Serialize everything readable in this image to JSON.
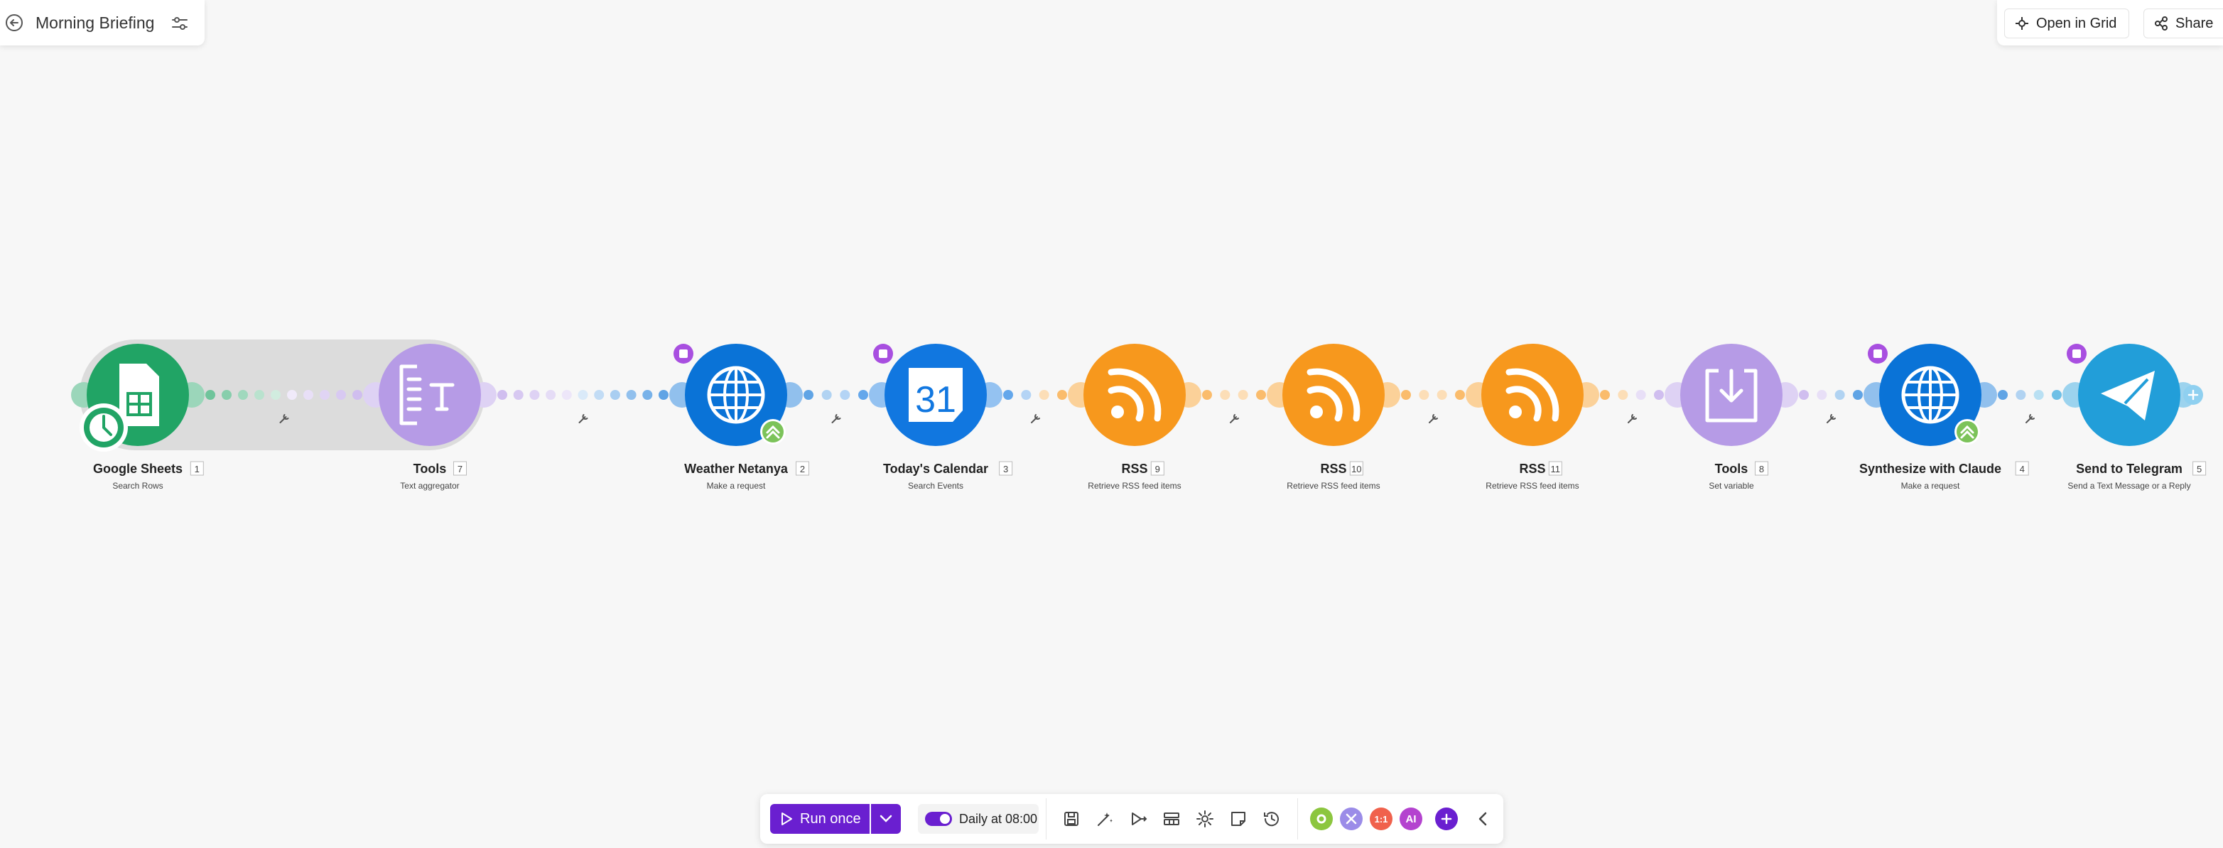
{
  "header": {
    "title": "Morning Briefing"
  },
  "topbar": {
    "open_grid_label": "Open in Grid",
    "share_label": "Share"
  },
  "colors": {
    "sheets_green": "#21a465",
    "tools_purple": "#b69be6",
    "http_blue": "#0a73d7",
    "rss_orange": "#f7981d",
    "telegram_blue": "#229ed9",
    "accent_purple": "#6a1fd0"
  },
  "modules": [
    {
      "name": "Google Sheets",
      "id": "1",
      "action": "Search Rows",
      "icon": "google-sheets-icon",
      "color": "#21a465",
      "trigger": true
    },
    {
      "name": "Tools",
      "id": "7",
      "action": "Text aggregator",
      "icon": "text-aggregator-icon",
      "color": "#b69be6"
    },
    {
      "name": "Weather Netanya",
      "id": "2",
      "action": "Make a request",
      "icon": "globe-icon",
      "color": "#0a73d7",
      "note": true,
      "upgrade": true
    },
    {
      "name": "Today's Calendar",
      "id": "3",
      "action": "Search Events",
      "icon": "calendar-icon",
      "color": "#1177e0",
      "note": true,
      "calendar_day": "31"
    },
    {
      "name": "RSS",
      "id": "9",
      "action": "Retrieve RSS feed items",
      "icon": "rss-icon",
      "color": "#f7981d"
    },
    {
      "name": "RSS",
      "id": "10",
      "action": "Retrieve RSS feed items",
      "icon": "rss-icon",
      "color": "#f7981d"
    },
    {
      "name": "RSS",
      "id": "11",
      "action": "Retrieve RSS feed items",
      "icon": "rss-icon",
      "color": "#f7981d"
    },
    {
      "name": "Tools",
      "id": "8",
      "action": "Set variable",
      "icon": "set-variable-icon",
      "color": "#b69be6"
    },
    {
      "name": "Synthesize with Claude",
      "id": "4",
      "action": "Make a request",
      "icon": "globe-icon",
      "color": "#0a73d7",
      "note": true,
      "upgrade": true
    },
    {
      "name": "Send to Telegram",
      "id": "5",
      "action": "Send a Text Message or a Reply",
      "icon": "telegram-icon",
      "color": "#229ed9",
      "note": true
    }
  ],
  "toolbar": {
    "run_label": "Run once",
    "schedule_label": "Daily at 08:00",
    "schedule_on": true,
    "tool_icons": [
      "save-icon",
      "auto-align-icon",
      "explain-flow-icon",
      "layout-icon",
      "settings-icon",
      "notes-icon",
      "history-icon"
    ],
    "badges": [
      {
        "icon": "gear-badge-icon",
        "color": "#8cc63f",
        "text": ""
      },
      {
        "icon": "tools-badge-icon",
        "color": "#9b8ce8",
        "text": ""
      },
      {
        "icon": "flow-badge-icon",
        "color": "#f0614c",
        "text": "1:1"
      },
      {
        "icon": "ai-badge-icon",
        "color": "#b443cf",
        "text": "AI"
      }
    ]
  }
}
